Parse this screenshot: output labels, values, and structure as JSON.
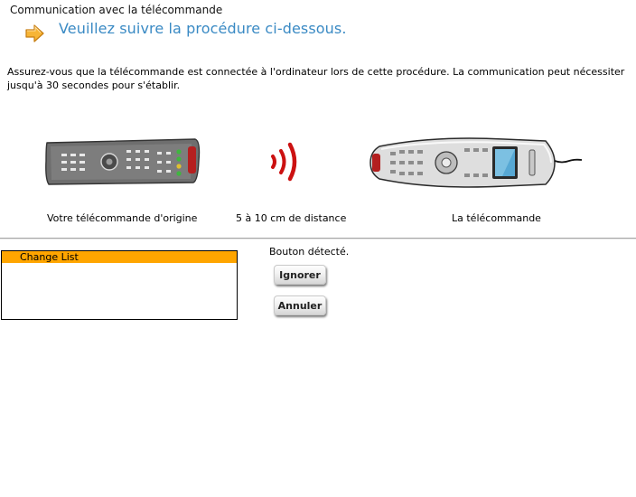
{
  "window": {
    "title": "Communication avec la télécommande"
  },
  "header": {
    "title": "Veuillez suivre la procédure ci-dessous."
  },
  "instructions": "Assurez-vous que la télécommande est connectée à l'ordinateur lors de cette procédure. La communication peut nécessiter jusqu'à 30 secondes pour s'établir.",
  "illustration": {
    "origin_caption": "Votre télécommande d'origine",
    "distance_caption": "5 à 10 cm de distance",
    "harmony_caption": "La télécommande"
  },
  "change_list": {
    "items": [
      "Change List"
    ],
    "selected_color": "#ffa500"
  },
  "status": "Bouton détecté.",
  "buttons": {
    "ignore_label": "Ignorer",
    "cancel_label": "Annuler"
  },
  "colors": {
    "heading": "#3a8ac4",
    "arrow": "#f5a623",
    "signal": "#cc1111"
  },
  "icons": [
    "arrow-right-icon",
    "ir-signal-icon"
  ]
}
